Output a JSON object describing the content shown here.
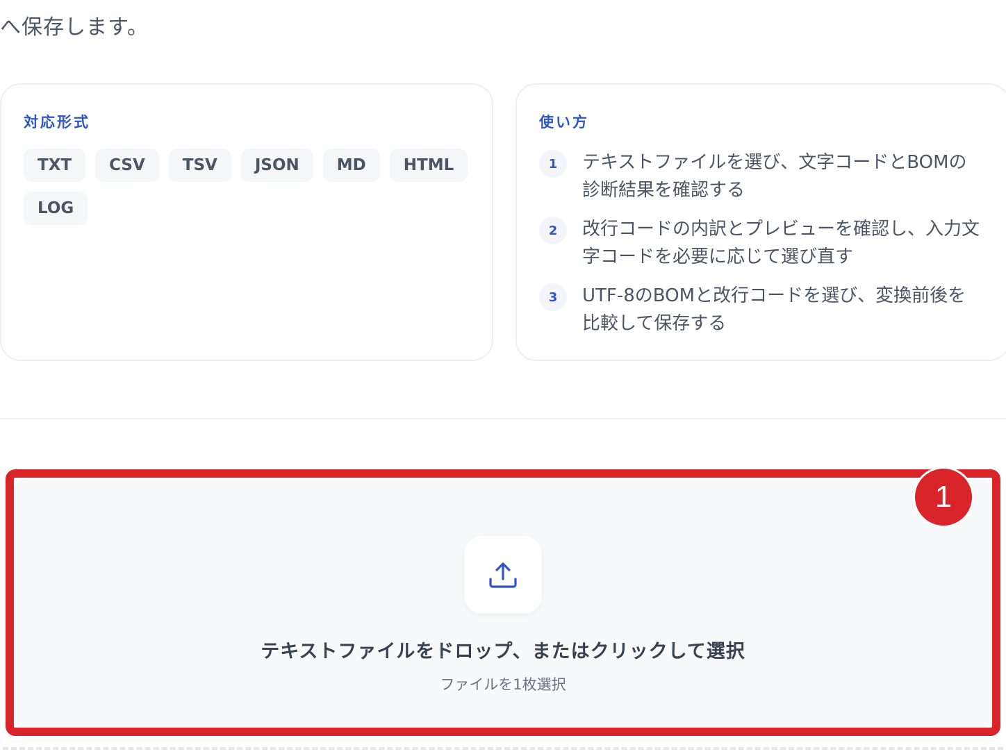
{
  "intro_text": "へ保存します。",
  "formats_card": {
    "title": "対応形式",
    "chips": [
      "TXT",
      "CSV",
      "TSV",
      "JSON",
      "MD",
      "HTML",
      "LOG"
    ]
  },
  "howto_card": {
    "title": "使い方",
    "steps": [
      {
        "num": "1",
        "text": "テキストファイルを選び、文字コードとBOMの診断結果を確認する"
      },
      {
        "num": "2",
        "text": "改行コードの内訳とプレビューを確認し、入力文字コードを必要に応じて選び直す"
      },
      {
        "num": "3",
        "text": "UTF-8のBOMと改行コードを選び、変換前後を比較して保存する"
      }
    ]
  },
  "dropzone": {
    "icon": "upload-icon",
    "title": "テキストファイルをドロップ、またはクリックして選択",
    "subtitle": "ファイルを1枚選択",
    "badge": "1"
  },
  "colors": {
    "accent": "#2f55c8",
    "highlight": "#d9242a"
  }
}
